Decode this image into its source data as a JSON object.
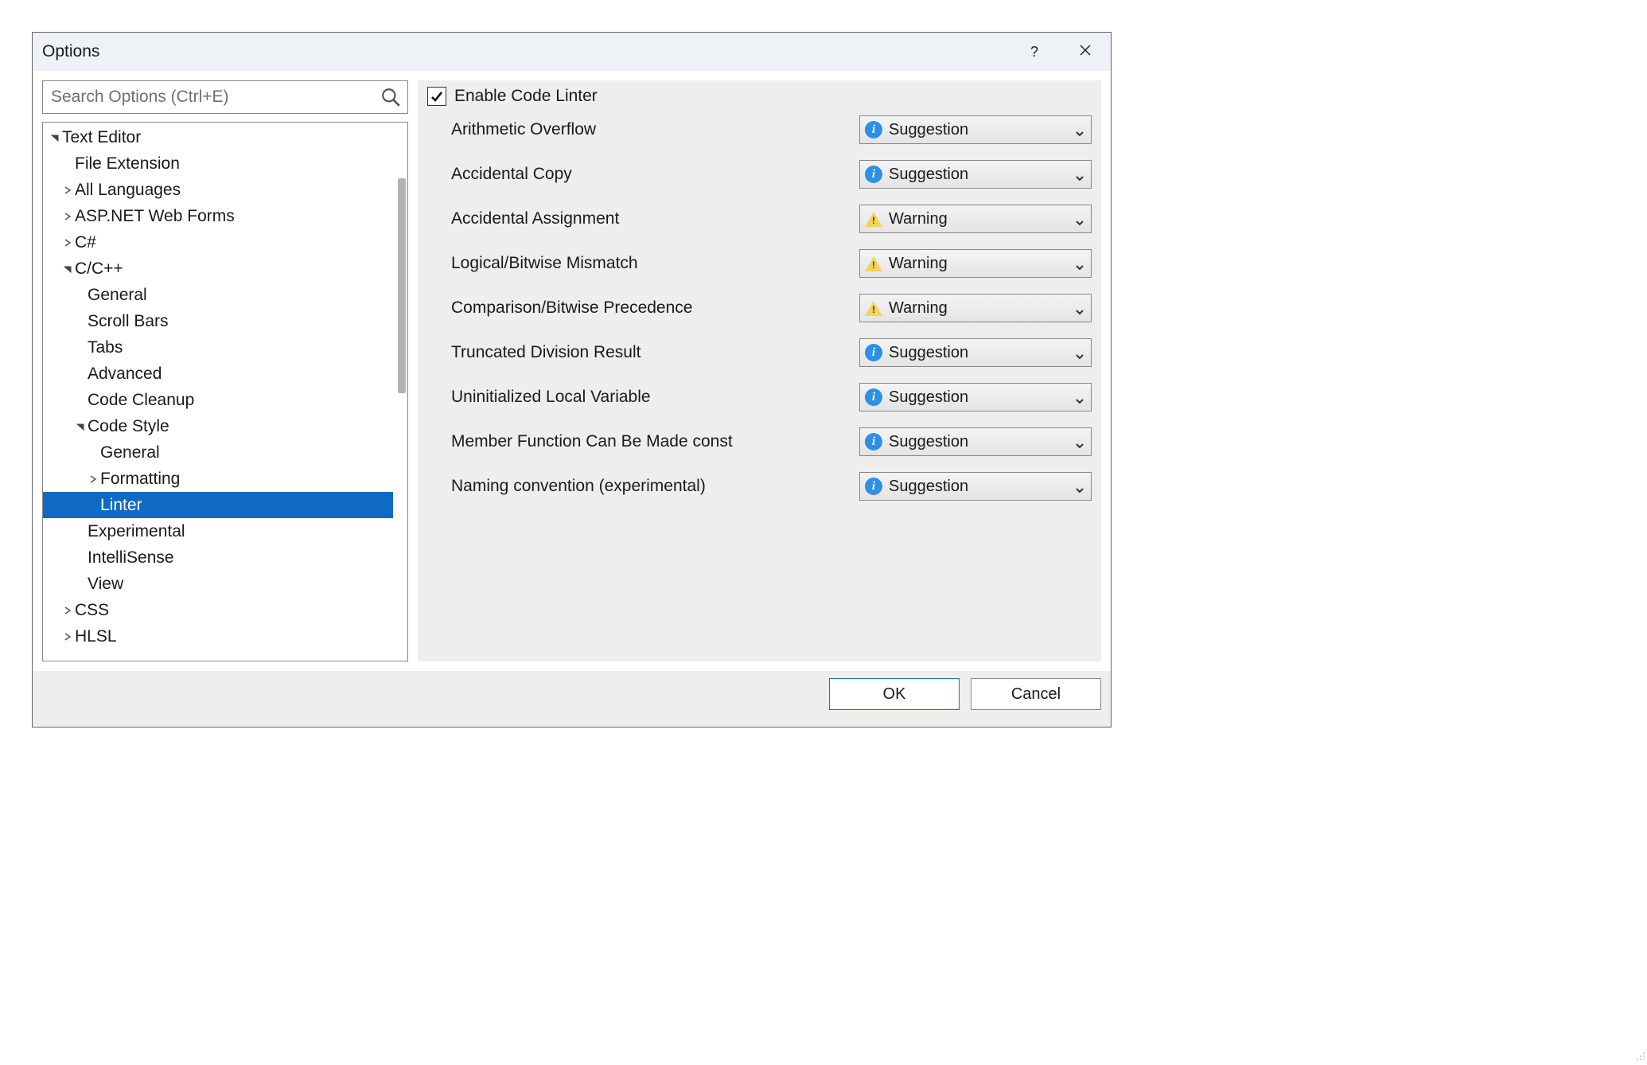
{
  "titlebar": {
    "title": "Options",
    "help_tooltip": "?",
    "close_tooltip": "Close"
  },
  "search": {
    "placeholder": "Search Options (Ctrl+E)"
  },
  "tree": [
    {
      "label": "Text Editor",
      "depth": 0,
      "arrow": "down",
      "selected": false
    },
    {
      "label": "File Extension",
      "depth": 1,
      "arrow": "none",
      "selected": false
    },
    {
      "label": "All Languages",
      "depth": 1,
      "arrow": "right",
      "selected": false
    },
    {
      "label": "ASP.NET Web Forms",
      "depth": 1,
      "arrow": "right",
      "selected": false
    },
    {
      "label": "C#",
      "depth": 1,
      "arrow": "right",
      "selected": false
    },
    {
      "label": "C/C++",
      "depth": 1,
      "arrow": "down",
      "selected": false
    },
    {
      "label": "General",
      "depth": 2,
      "arrow": "none",
      "selected": false
    },
    {
      "label": "Scroll Bars",
      "depth": 2,
      "arrow": "none",
      "selected": false
    },
    {
      "label": "Tabs",
      "depth": 2,
      "arrow": "none",
      "selected": false
    },
    {
      "label": "Advanced",
      "depth": 2,
      "arrow": "none",
      "selected": false
    },
    {
      "label": "Code Cleanup",
      "depth": 2,
      "arrow": "none",
      "selected": false
    },
    {
      "label": "Code Style",
      "depth": 2,
      "arrow": "down",
      "selected": false
    },
    {
      "label": "General",
      "depth": 3,
      "arrow": "none",
      "selected": false
    },
    {
      "label": "Formatting",
      "depth": 3,
      "arrow": "right",
      "selected": false
    },
    {
      "label": "Linter",
      "depth": 3,
      "arrow": "none",
      "selected": true
    },
    {
      "label": "Experimental",
      "depth": 2,
      "arrow": "none",
      "selected": false
    },
    {
      "label": "IntelliSense",
      "depth": 2,
      "arrow": "none",
      "selected": false
    },
    {
      "label": "View",
      "depth": 2,
      "arrow": "none",
      "selected": false
    },
    {
      "label": "CSS",
      "depth": 1,
      "arrow": "right",
      "selected": false
    },
    {
      "label": "HLSL",
      "depth": 1,
      "arrow": "right",
      "selected": false
    }
  ],
  "panel": {
    "enable_label": "Enable Code Linter",
    "enable_checked": true,
    "rules": [
      {
        "label": "Arithmetic Overflow",
        "level": "Suggestion"
      },
      {
        "label": "Accidental Copy",
        "level": "Suggestion"
      },
      {
        "label": "Accidental Assignment",
        "level": "Warning"
      },
      {
        "label": "Logical/Bitwise Mismatch",
        "level": "Warning"
      },
      {
        "label": "Comparison/Bitwise Precedence",
        "level": "Warning"
      },
      {
        "label": "Truncated Division Result",
        "level": "Suggestion"
      },
      {
        "label": "Uninitialized Local Variable",
        "level": "Suggestion"
      },
      {
        "label": "Member Function Can Be Made const",
        "level": "Suggestion"
      },
      {
        "label": "Naming convention (experimental)",
        "level": "Suggestion"
      }
    ]
  },
  "footer": {
    "ok": "OK",
    "cancel": "Cancel"
  }
}
